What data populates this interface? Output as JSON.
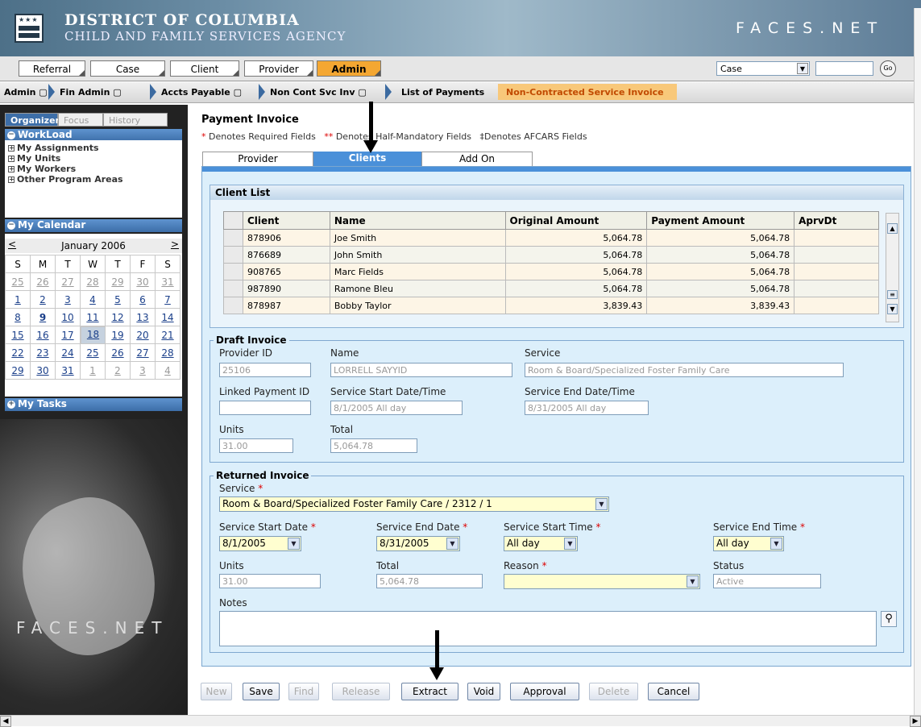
{
  "header": {
    "title": "DISTRICT OF COLUMBIA",
    "subtitle": "CHILD AND FAMILY SERVICES AGENCY",
    "logo": "FACES.NET"
  },
  "topnav": {
    "tabs": [
      "Referral",
      "Case",
      "Client",
      "Provider",
      "Admin"
    ],
    "active": "Admin",
    "search_type": "Case",
    "search_value": "",
    "go_label": "Go"
  },
  "breadcrumb": {
    "items": [
      "Admin",
      "Fin Admin",
      "Accts Payable",
      "Non Cont Svc Inv",
      "List of Payments"
    ],
    "active": "Non-Contracted Service Invoice"
  },
  "sidebar": {
    "tabs": [
      "Organizer",
      "Focus",
      "History"
    ],
    "workload_title": "WorkLoad",
    "workload_items": [
      "My Assignments",
      "My Units",
      "My Workers",
      "Other Program Areas"
    ],
    "calendar_title": "My Calendar",
    "calendar_month": "January 2006",
    "calendar_prev": "<",
    "calendar_next": ">",
    "day_names": [
      "S",
      "M",
      "T",
      "W",
      "T",
      "F",
      "S"
    ],
    "weeks": [
      [
        "25",
        "26",
        "27",
        "28",
        "29",
        "30",
        "31"
      ],
      [
        "1",
        "2",
        "3",
        "4",
        "5",
        "6",
        "7"
      ],
      [
        "8",
        "9",
        "10",
        "11",
        "12",
        "13",
        "14"
      ],
      [
        "15",
        "16",
        "17",
        "18",
        "19",
        "20",
        "21"
      ],
      [
        "22",
        "23",
        "24",
        "25",
        "26",
        "27",
        "28"
      ],
      [
        "29",
        "30",
        "31",
        "1",
        "2",
        "3",
        "4"
      ]
    ],
    "tasks_title": "My Tasks",
    "logo": "FACES.NET"
  },
  "main": {
    "title": "Payment Invoice",
    "legend": {
      "req_mark": "*",
      "req_text": "Denotes Required Fields",
      "half_mark": "**",
      "half_text": "Denotes Half-Mandatory Fields",
      "afcars_text": "‡Denotes AFCARS Fields"
    },
    "tabs": [
      "Provider",
      "Clients",
      "Add On"
    ],
    "active_tab": "Clients"
  },
  "client_list": {
    "title": "Client List",
    "columns": [
      "Client",
      "Name",
      "Original Amount",
      "Payment Amount",
      "AprvDt"
    ],
    "rows": [
      [
        "878906",
        "Joe Smith",
        "5,064.78",
        "5,064.78",
        ""
      ],
      [
        "876689",
        "John Smith",
        "5,064.78",
        "5,064.78",
        ""
      ],
      [
        "908765",
        "Marc Fields",
        "5,064.78",
        "5,064.78",
        ""
      ],
      [
        "987890",
        "Ramone Bleu",
        "5,064.78",
        "5,064.78",
        ""
      ],
      [
        "878987",
        "Bobby Taylor",
        "3,839.43",
        "3,839.43",
        ""
      ]
    ]
  },
  "draft_invoice": {
    "legend": "Draft Invoice",
    "provider_id_label": "Provider ID",
    "provider_id": "25106",
    "name_label": "Name",
    "name": "LORRELL SAYYID",
    "service_label": "Service",
    "service": "Room & Board/Specialized Foster Family Care",
    "linked_label": "Linked Payment ID",
    "linked": "",
    "start_label": "Service Start Date/Time",
    "start": "8/1/2005 All day",
    "end_label": "Service End Date/Time",
    "end": "8/31/2005 All day",
    "units_label": "Units",
    "units": "31.00",
    "total_label": "Total",
    "total": "5,064.78"
  },
  "returned_invoice": {
    "legend": "Returned Invoice",
    "service_label": "Service",
    "service": "Room & Board/Specialized Foster Family Care / 2312 / 1",
    "start_date_label": "Service Start Date",
    "start_date": "8/1/2005",
    "end_date_label": "Service End Date",
    "end_date": "8/31/2005",
    "start_time_label": "Service Start Time",
    "start_time": "All day",
    "end_time_label": "Service End Time",
    "end_time": "All day",
    "units_label": "Units",
    "units": "31.00",
    "total_label": "Total",
    "total": "5,064.78",
    "reason_label": "Reason",
    "reason": "",
    "status_label": "Status",
    "status": "Active",
    "notes_label": "Notes",
    "notes": "",
    "req_mark": "*"
  },
  "buttons": [
    "New",
    "Save",
    "Find",
    "Release",
    "Extract",
    "Void",
    "Approval",
    "Delete",
    "Cancel"
  ],
  "icons": {
    "dropdown": "chevron-down-icon",
    "search": "magnifier-icon",
    "annotation": "down-arrow-annotation"
  },
  "colors": {
    "active_tab": "#4a90d9",
    "admin_tab": "#f4a732",
    "required_field": "#fffed0",
    "panel_bg": "#dceffb"
  }
}
